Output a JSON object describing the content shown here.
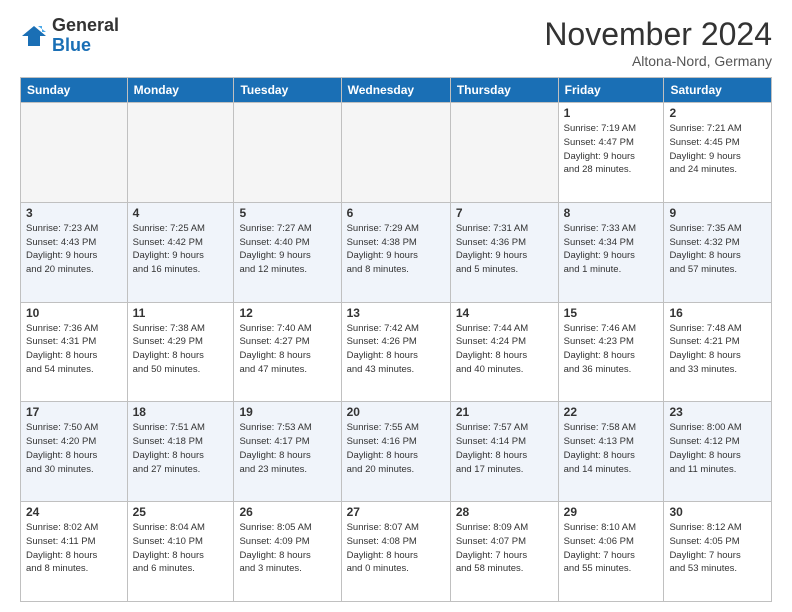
{
  "logo": {
    "general": "General",
    "blue": "Blue"
  },
  "header": {
    "month": "November 2024",
    "location": "Altona-Nord, Germany"
  },
  "weekdays": [
    "Sunday",
    "Monday",
    "Tuesday",
    "Wednesday",
    "Thursday",
    "Friday",
    "Saturday"
  ],
  "weeks": [
    [
      {
        "day": "",
        "info": ""
      },
      {
        "day": "",
        "info": ""
      },
      {
        "day": "",
        "info": ""
      },
      {
        "day": "",
        "info": ""
      },
      {
        "day": "",
        "info": ""
      },
      {
        "day": "1",
        "info": "Sunrise: 7:19 AM\nSunset: 4:47 PM\nDaylight: 9 hours\nand 28 minutes."
      },
      {
        "day": "2",
        "info": "Sunrise: 7:21 AM\nSunset: 4:45 PM\nDaylight: 9 hours\nand 24 minutes."
      }
    ],
    [
      {
        "day": "3",
        "info": "Sunrise: 7:23 AM\nSunset: 4:43 PM\nDaylight: 9 hours\nand 20 minutes."
      },
      {
        "day": "4",
        "info": "Sunrise: 7:25 AM\nSunset: 4:42 PM\nDaylight: 9 hours\nand 16 minutes."
      },
      {
        "day": "5",
        "info": "Sunrise: 7:27 AM\nSunset: 4:40 PM\nDaylight: 9 hours\nand 12 minutes."
      },
      {
        "day": "6",
        "info": "Sunrise: 7:29 AM\nSunset: 4:38 PM\nDaylight: 9 hours\nand 8 minutes."
      },
      {
        "day": "7",
        "info": "Sunrise: 7:31 AM\nSunset: 4:36 PM\nDaylight: 9 hours\nand 5 minutes."
      },
      {
        "day": "8",
        "info": "Sunrise: 7:33 AM\nSunset: 4:34 PM\nDaylight: 9 hours\nand 1 minute."
      },
      {
        "day": "9",
        "info": "Sunrise: 7:35 AM\nSunset: 4:32 PM\nDaylight: 8 hours\nand 57 minutes."
      }
    ],
    [
      {
        "day": "10",
        "info": "Sunrise: 7:36 AM\nSunset: 4:31 PM\nDaylight: 8 hours\nand 54 minutes."
      },
      {
        "day": "11",
        "info": "Sunrise: 7:38 AM\nSunset: 4:29 PM\nDaylight: 8 hours\nand 50 minutes."
      },
      {
        "day": "12",
        "info": "Sunrise: 7:40 AM\nSunset: 4:27 PM\nDaylight: 8 hours\nand 47 minutes."
      },
      {
        "day": "13",
        "info": "Sunrise: 7:42 AM\nSunset: 4:26 PM\nDaylight: 8 hours\nand 43 minutes."
      },
      {
        "day": "14",
        "info": "Sunrise: 7:44 AM\nSunset: 4:24 PM\nDaylight: 8 hours\nand 40 minutes."
      },
      {
        "day": "15",
        "info": "Sunrise: 7:46 AM\nSunset: 4:23 PM\nDaylight: 8 hours\nand 36 minutes."
      },
      {
        "day": "16",
        "info": "Sunrise: 7:48 AM\nSunset: 4:21 PM\nDaylight: 8 hours\nand 33 minutes."
      }
    ],
    [
      {
        "day": "17",
        "info": "Sunrise: 7:50 AM\nSunset: 4:20 PM\nDaylight: 8 hours\nand 30 minutes."
      },
      {
        "day": "18",
        "info": "Sunrise: 7:51 AM\nSunset: 4:18 PM\nDaylight: 8 hours\nand 27 minutes."
      },
      {
        "day": "19",
        "info": "Sunrise: 7:53 AM\nSunset: 4:17 PM\nDaylight: 8 hours\nand 23 minutes."
      },
      {
        "day": "20",
        "info": "Sunrise: 7:55 AM\nSunset: 4:16 PM\nDaylight: 8 hours\nand 20 minutes."
      },
      {
        "day": "21",
        "info": "Sunrise: 7:57 AM\nSunset: 4:14 PM\nDaylight: 8 hours\nand 17 minutes."
      },
      {
        "day": "22",
        "info": "Sunrise: 7:58 AM\nSunset: 4:13 PM\nDaylight: 8 hours\nand 14 minutes."
      },
      {
        "day": "23",
        "info": "Sunrise: 8:00 AM\nSunset: 4:12 PM\nDaylight: 8 hours\nand 11 minutes."
      }
    ],
    [
      {
        "day": "24",
        "info": "Sunrise: 8:02 AM\nSunset: 4:11 PM\nDaylight: 8 hours\nand 8 minutes."
      },
      {
        "day": "25",
        "info": "Sunrise: 8:04 AM\nSunset: 4:10 PM\nDaylight: 8 hours\nand 6 minutes."
      },
      {
        "day": "26",
        "info": "Sunrise: 8:05 AM\nSunset: 4:09 PM\nDaylight: 8 hours\nand 3 minutes."
      },
      {
        "day": "27",
        "info": "Sunrise: 8:07 AM\nSunset: 4:08 PM\nDaylight: 8 hours\nand 0 minutes."
      },
      {
        "day": "28",
        "info": "Sunrise: 8:09 AM\nSunset: 4:07 PM\nDaylight: 7 hours\nand 58 minutes."
      },
      {
        "day": "29",
        "info": "Sunrise: 8:10 AM\nSunset: 4:06 PM\nDaylight: 7 hours\nand 55 minutes."
      },
      {
        "day": "30",
        "info": "Sunrise: 8:12 AM\nSunset: 4:05 PM\nDaylight: 7 hours\nand 53 minutes."
      }
    ]
  ]
}
